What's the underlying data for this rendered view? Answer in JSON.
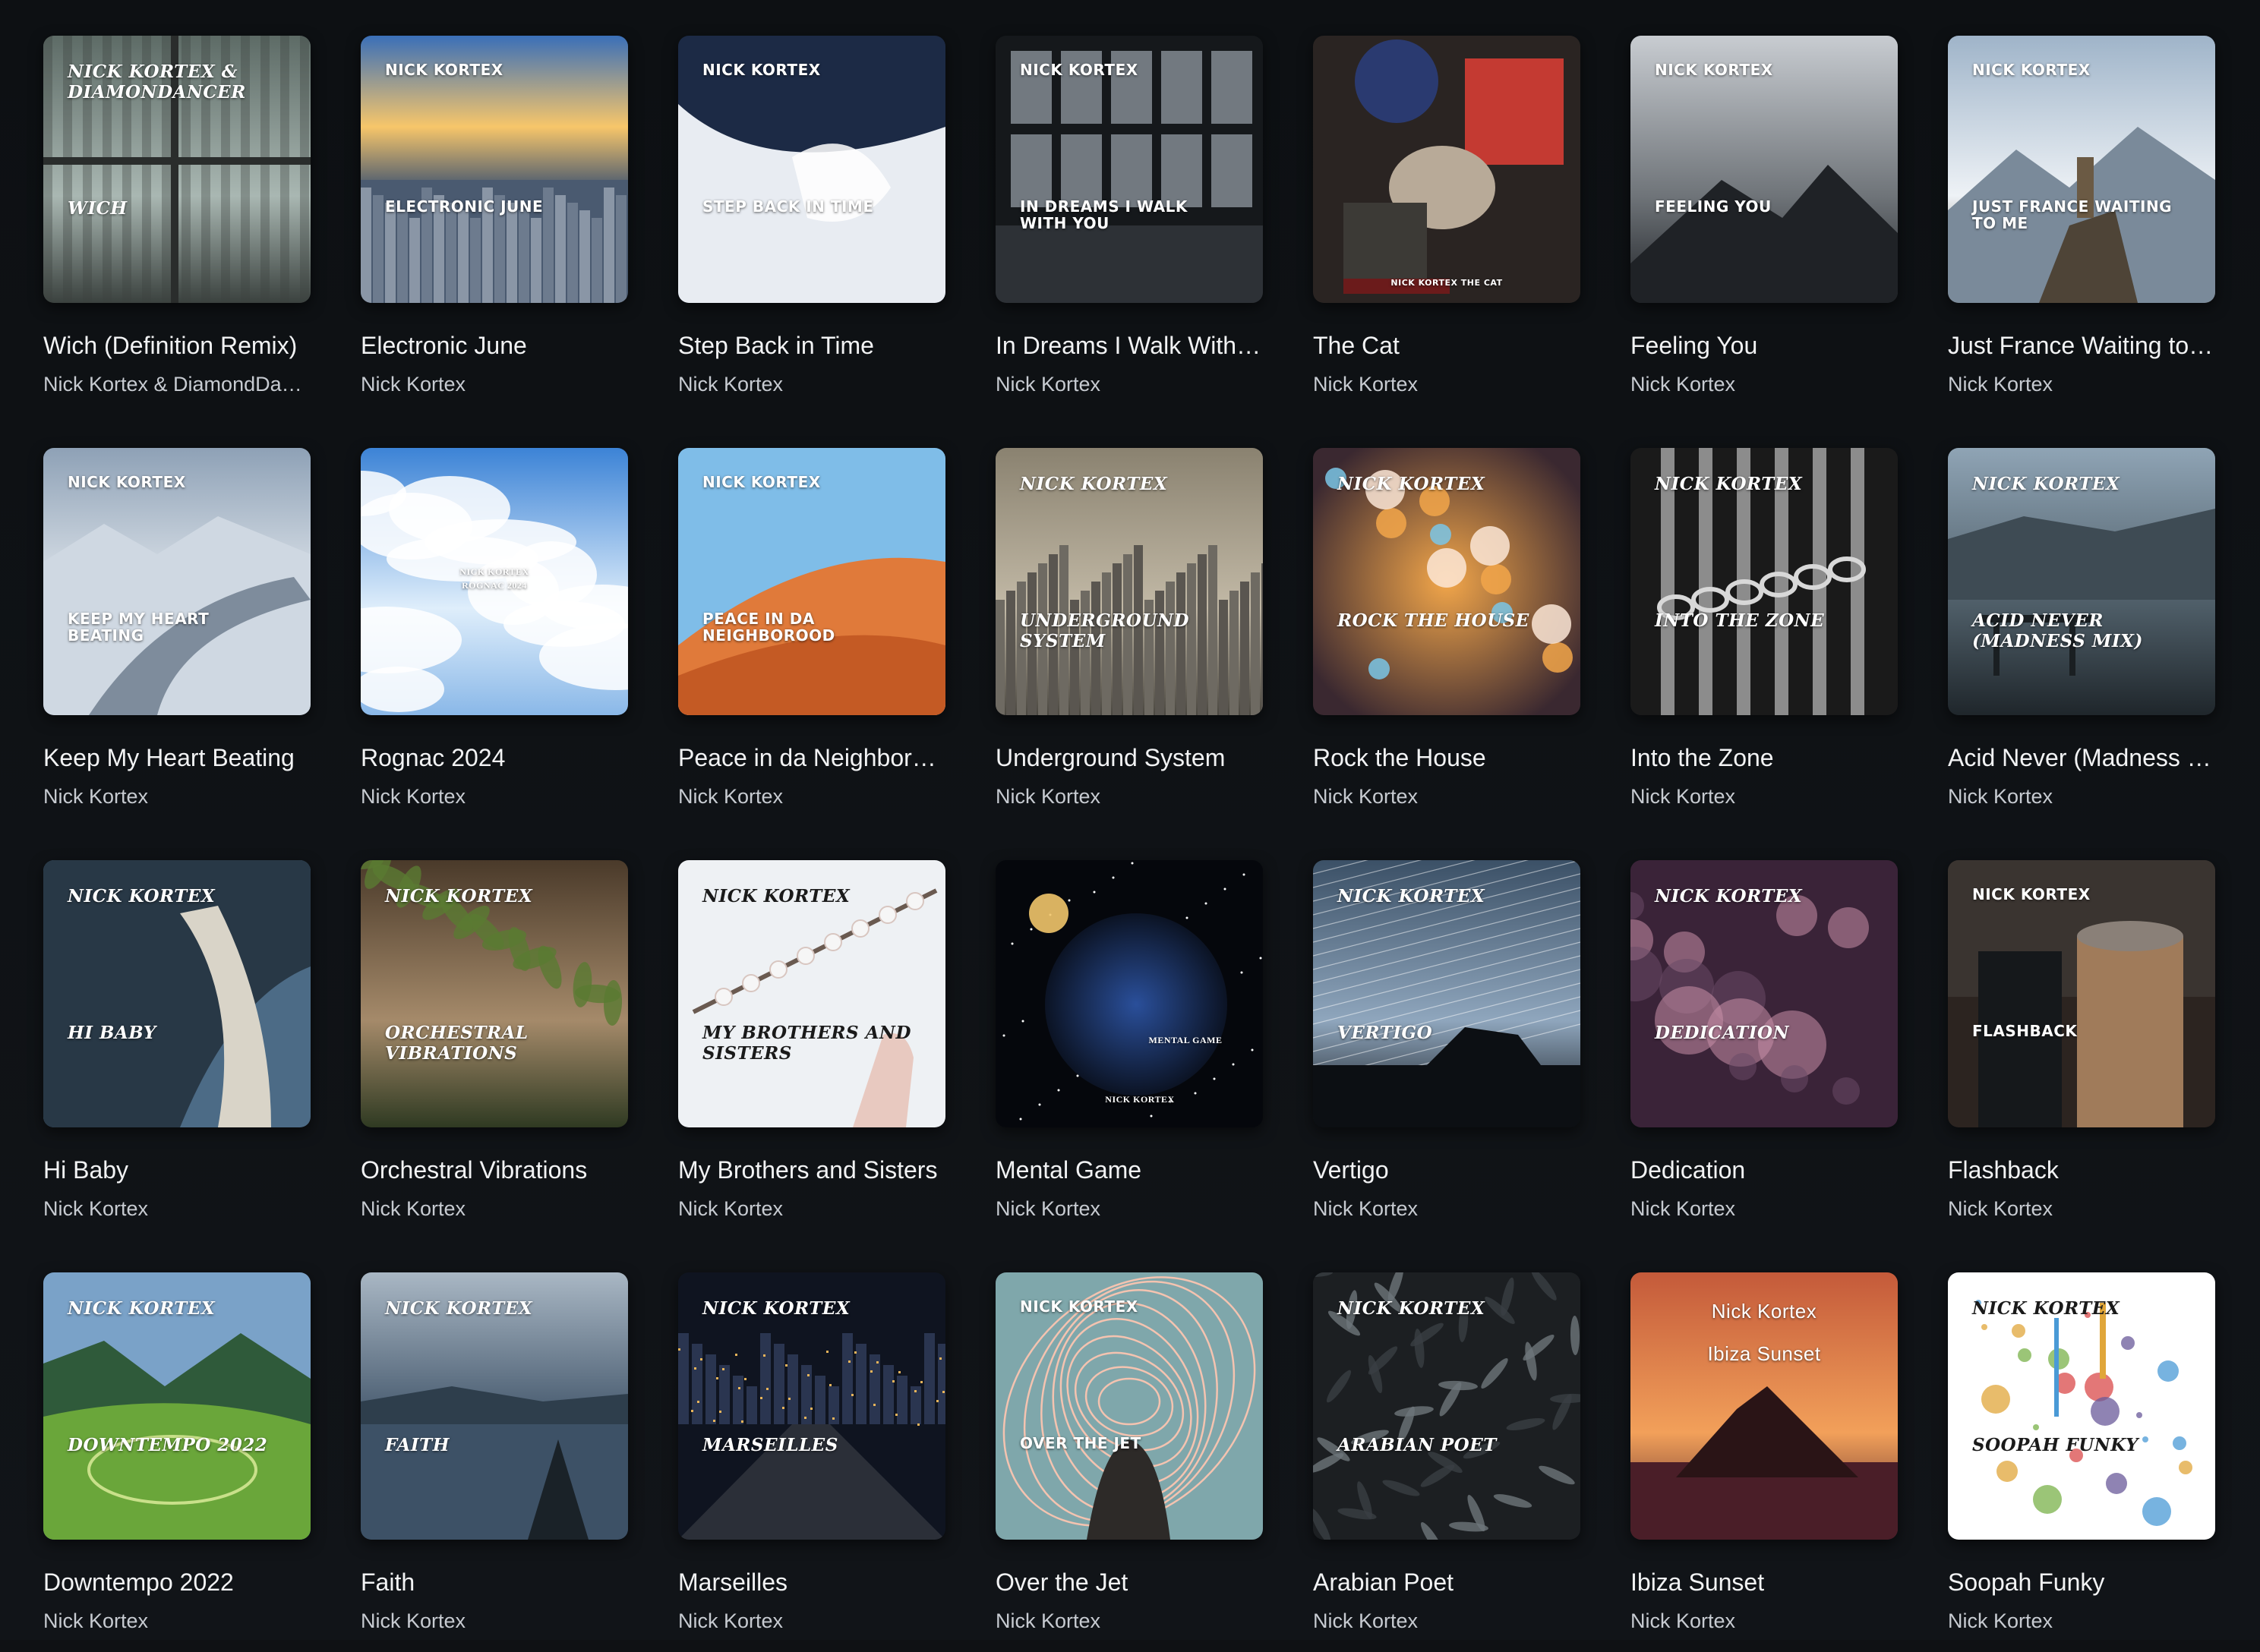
{
  "albums": [
    {
      "title": "Wich (Definition Remix)",
      "artist": "Nick Kortex & DiamondDancer",
      "cover_artist": "NICK KORTEX & DIAMONDANCER",
      "cover_title": "WICH",
      "style": "italic",
      "palette": [
        "#5d6b66",
        "#a9b7b2",
        "#3b423f"
      ],
      "motif": "curtain"
    },
    {
      "title": "Electronic June",
      "artist": "Nick Kortex",
      "cover_artist": "NICK KORTEX",
      "cover_title": "ELECTRONIC JUNE",
      "style": "block",
      "palette": [
        "#3a6fb8",
        "#f7c66a",
        "#4a5a70"
      ],
      "motif": "city"
    },
    {
      "title": "Step Back in Time",
      "artist": "Nick Kortex",
      "cover_artist": "NICK KORTEX",
      "cover_title": "STEP BACK IN TIME",
      "style": "block",
      "palette": [
        "#1c2a45",
        "#e8ecf2",
        "#4a5f82"
      ],
      "motif": "snow"
    },
    {
      "title": "In Dreams I Walk With You",
      "artist": "Nick Kortex",
      "cover_artist": "NICK KORTEX",
      "cover_title": "IN DREAMS I WALK WITH YOU",
      "style": "block",
      "palette": [
        "#2d3136",
        "#9aa3ab",
        "#15181b"
      ],
      "motif": "window"
    },
    {
      "title": "The Cat",
      "artist": "Nick Kortex",
      "cover_artist": "",
      "cover_title": "NICK KORTEX   THE CAT",
      "style": "tag",
      "palette": [
        "#6b1b1b",
        "#c43a32",
        "#2a2422"
      ],
      "motif": "cat"
    },
    {
      "title": "Feeling You",
      "artist": "Nick Kortex",
      "cover_artist": "NICK KORTEX",
      "cover_title": "FEELING YOU",
      "style": "block",
      "palette": [
        "#c8ccd1",
        "#6f7479",
        "#1f2226"
      ],
      "motif": "mountain"
    },
    {
      "title": "Just France Waiting to Me",
      "artist": "Nick Kortex",
      "cover_artist": "NICK KORTEX",
      "cover_title": "JUST FRANCE WAITING TO ME",
      "style": "block",
      "palette": [
        "#9fb4c9",
        "#eef2f6",
        "#4e4437"
      ],
      "motif": "peak"
    },
    {
      "title": "Keep My Heart Beating",
      "artist": "Nick Kortex",
      "cover_artist": "NICK KORTEX",
      "cover_title": "KEEP MY HEART BEATING",
      "style": "block",
      "palette": [
        "#8ea1b6",
        "#e6ebf0",
        "#3e4550"
      ],
      "motif": "glacier"
    },
    {
      "title": "Rognac 2024",
      "artist": "Nick Kortex",
      "cover_artist": "NICK KORTEX",
      "cover_title": "ROGNAC 2024",
      "style": "tiny",
      "palette": [
        "#3c83d6",
        "#dfeefb",
        "#8ab8e8"
      ],
      "motif": "clouds"
    },
    {
      "title": "Peace in da Neighborood",
      "artist": "Nick Kortex",
      "cover_artist": "NICK KORTEX",
      "cover_title": "PEACE IN DA NEIGHBOROOD",
      "style": "block",
      "palette": [
        "#7fbde8",
        "#e07a3a",
        "#c45a24"
      ],
      "motif": "dune"
    },
    {
      "title": "Underground System",
      "artist": "Nick Kortex",
      "cover_artist": "NICK KORTEX",
      "cover_title": "UNDERGROUND SYSTEM",
      "style": "italic",
      "palette": [
        "#8a8270",
        "#c2b9a6",
        "#4a4740"
      ],
      "motif": "skyline"
    },
    {
      "title": "Rock the House",
      "artist": "Nick Kortex",
      "cover_artist": "NICK KORTEX",
      "cover_title": "ROCK THE HOUSE",
      "style": "italic",
      "palette": [
        "#3a2830",
        "#f2a64a",
        "#7ac6e6"
      ],
      "motif": "hearts"
    },
    {
      "title": "Into the Zone",
      "artist": "Nick Kortex",
      "cover_artist": "NICK KORTEX",
      "cover_title": "INTO THE ZONE",
      "style": "italic",
      "palette": [
        "#1a1a1a",
        "#bdbdbd",
        "#5a5a5a"
      ],
      "motif": "chain"
    },
    {
      "title": "Acid Never (Madness Mix)",
      "artist": "Nick Kortex",
      "cover_artist": "NICK KORTEX",
      "cover_title": "ACID NEVER (MADNESS MIX)",
      "style": "italic",
      "palette": [
        "#8fa4b5",
        "#4d5c66",
        "#1f262b"
      ],
      "motif": "lake"
    },
    {
      "title": "Hi Baby",
      "artist": "Nick Kortex",
      "cover_artist": "NICK KORTEX",
      "cover_title": "HI BABY",
      "style": "italic",
      "palette": [
        "#4c6b86",
        "#d9d4c8",
        "#283846"
      ],
      "motif": "coast"
    },
    {
      "title": "Orchestral Vibrations",
      "artist": "Nick Kortex",
      "cover_artist": "NICK KORTEX",
      "cover_title": "ORCHESTRAL VIBRATIONS",
      "style": "italic",
      "palette": [
        "#4a3a2a",
        "#a58a6a",
        "#2f3a22"
      ],
      "motif": "leaves"
    },
    {
      "title": "My Brothers and Sisters",
      "artist": "Nick Kortex",
      "cover_artist": "NICK KORTEX",
      "cover_title": "MY BROTHERS AND SISTERS",
      "style": "italic-dark",
      "palette": [
        "#eef1f4",
        "#cfd6de",
        "#e8c9c0"
      ],
      "motif": "branch"
    },
    {
      "title": "Mental Game",
      "artist": "Nick Kortex",
      "cover_artist": "NICK KORTEX",
      "cover_title": "MENTAL GAME",
      "style": "serif-small",
      "palette": [
        "#05070c",
        "#2a4f9a",
        "#f1c56a"
      ],
      "motif": "orb"
    },
    {
      "title": "Vertigo",
      "artist": "Nick Kortex",
      "cover_artist": "NICK KORTEX",
      "cover_title": "VERTIGO",
      "style": "italic",
      "palette": [
        "#3b5066",
        "#8fa6bd",
        "#0c0f13"
      ],
      "motif": "stars"
    },
    {
      "title": "Dedication",
      "artist": "Nick Kortex",
      "cover_artist": "NICK KORTEX",
      "cover_title": "DEDICATION",
      "style": "italic",
      "palette": [
        "#3a2338",
        "#c88fa8",
        "#6a4a66"
      ],
      "motif": "bokeh"
    },
    {
      "title": "Flashback",
      "artist": "Nick Kortex",
      "cover_artist": "NICK KORTEX",
      "cover_title": "FLASHBACK",
      "style": "block",
      "palette": [
        "#2c2420",
        "#a07b5a",
        "#4a6a86"
      ],
      "motif": "street"
    },
    {
      "title": "Downtempo 2022",
      "artist": "Nick Kortex",
      "cover_artist": "NICK KORTEX",
      "cover_title": "DOWNTEMPO 2022",
      "style": "italic",
      "palette": [
        "#6aa63a",
        "#c9e08a",
        "#2f5a3a"
      ],
      "motif": "valley"
    },
    {
      "title": "Faith",
      "artist": "Nick Kortex",
      "cover_artist": "NICK KORTEX",
      "cover_title": "FAITH",
      "style": "italic",
      "palette": [
        "#a9b7c4",
        "#3d5166",
        "#1b2530"
      ],
      "motif": "lake2"
    },
    {
      "title": "Marseilles",
      "artist": "Nick Kortex",
      "cover_artist": "NICK KORTEX",
      "cover_title": "MARSEILLES",
      "style": "italic",
      "palette": [
        "#0f1420",
        "#e8b45a",
        "#2a3550"
      ],
      "motif": "night"
    },
    {
      "title": "Over the Jet",
      "artist": "Nick Kortex",
      "cover_artist": "NICK KORTEX",
      "cover_title": "OVER THE JET",
      "style": "block",
      "palette": [
        "#7fa7ab",
        "#f4c3b0",
        "#2d2a28"
      ],
      "motif": "swirl"
    },
    {
      "title": "Arabian Poet",
      "artist": "Nick Kortex",
      "cover_artist": "NICK KORTEX",
      "cover_title": "ARABIAN POET",
      "style": "italic",
      "palette": [
        "#1c1f22",
        "#6e757b",
        "#3a3f44"
      ],
      "motif": "texture"
    },
    {
      "title": "Ibiza Sunset",
      "artist": "Nick Kortex",
      "cover_artist": "Nick Kortex",
      "cover_title": "Ibiza Sunset",
      "style": "plain",
      "palette": [
        "#c45a3a",
        "#f2a05a",
        "#4a1e28"
      ],
      "motif": "island"
    },
    {
      "title": "Soopah Funky",
      "artist": "Nick Kortex",
      "cover_artist": "NICK KORTEX",
      "cover_title": "SOOPAH FUNKY",
      "style": "italic-dark",
      "palette": [
        "#ffffff",
        "#4a9ad6",
        "#e0a63a"
      ],
      "motif": "splash"
    }
  ]
}
